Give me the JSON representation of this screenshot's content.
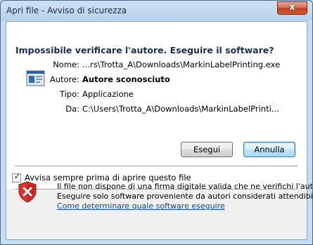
{
  "window": {
    "title": "Apri file - Avviso di sicurezza",
    "close_glyph": "x"
  },
  "dialog": {
    "heading": "Impossibile verificare l'autore. Eseguire il software?",
    "app_icon": "application-icon",
    "fields": [
      {
        "label": "Nome:",
        "value": "...rs\\Trotta_A\\Downloads\\MarkinLabelPrinting.exe"
      },
      {
        "label": "Autore:",
        "value": "Autore sconosciuto"
      },
      {
        "label": "Tipo:",
        "value": "Applicazione"
      },
      {
        "label": "Da:",
        "value": "C:\\Users\\Trotta_A\\Downloads\\MarkinLabelPrinti..."
      }
    ],
    "buttons": {
      "run": "Esegui",
      "cancel": "Annulla"
    },
    "checkbox": {
      "label": "Avvisa sempre prima di aprire questo file",
      "checked": true
    },
    "warning": {
      "icon": "shield-warning-icon",
      "line1": "Il file non dispone di una firma digitale valida che ne verifichi l'autore.",
      "line2": "Eseguire solo software proveniente da autori considerati attendibili.",
      "link": "Come determinare quale software eseguire"
    }
  },
  "colors": {
    "heading": "#1b2f54",
    "link": "#0645ad",
    "close_button": "#c2411f",
    "frame": "#b8d1ea"
  }
}
